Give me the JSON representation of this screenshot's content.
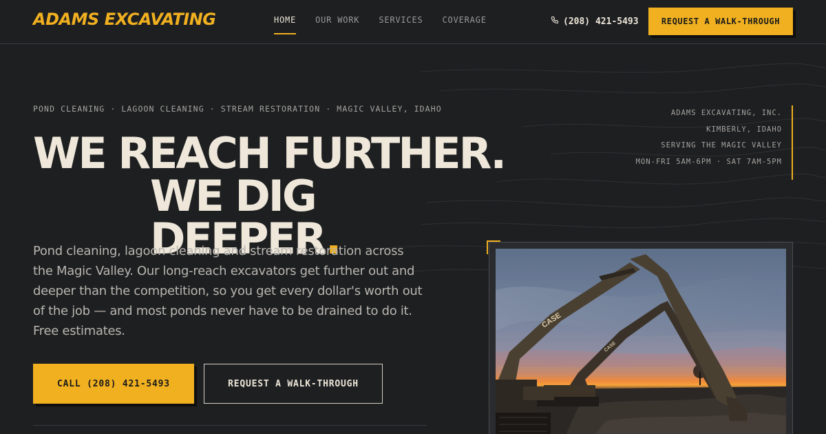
{
  "header": {
    "logo": "ADAMS EXCAVATING",
    "nav": [
      "HOME",
      "OUR WORK",
      "SERVICES",
      "COVERAGE"
    ],
    "active_nav": "HOME",
    "phone": "(208) 421-5493",
    "cta": "REQUEST A WALK-THROUGH"
  },
  "hero": {
    "eyebrow": "POND CLEANING · LAGOON CLEANING · STREAM RESTORATION · MAGIC VALLEY, IDAHO",
    "headline_line1": "WE REACH FURTHER.",
    "headline_line2": "WE DIG DEEPER",
    "headline_dot": ".",
    "description": "Pond cleaning, lagoon cleaning and stream restoration across the Magic Valley. Our long-reach excavators get further out and deeper than the competition, so you get every dollar's worth out of the job — and most ponds never have to be drained to do it. Free estimates.",
    "call_button": "CALL (208) 421-5493",
    "walkthrough_button": "REQUEST A WALK-THROUGH"
  },
  "info": {
    "company": "ADAMS EXCAVATING, INC.",
    "location": "KIMBERLY, IDAHO",
    "serving": "SERVING THE MAGIC VALLEY",
    "hours": "MON-FRI 5AM-6PM · SAT 7AM-5PM"
  },
  "photo": {
    "brand_mark": "CASE"
  },
  "colors": {
    "accent": "#f0b020",
    "background": "#1e1f21",
    "text": "#eee7da"
  }
}
